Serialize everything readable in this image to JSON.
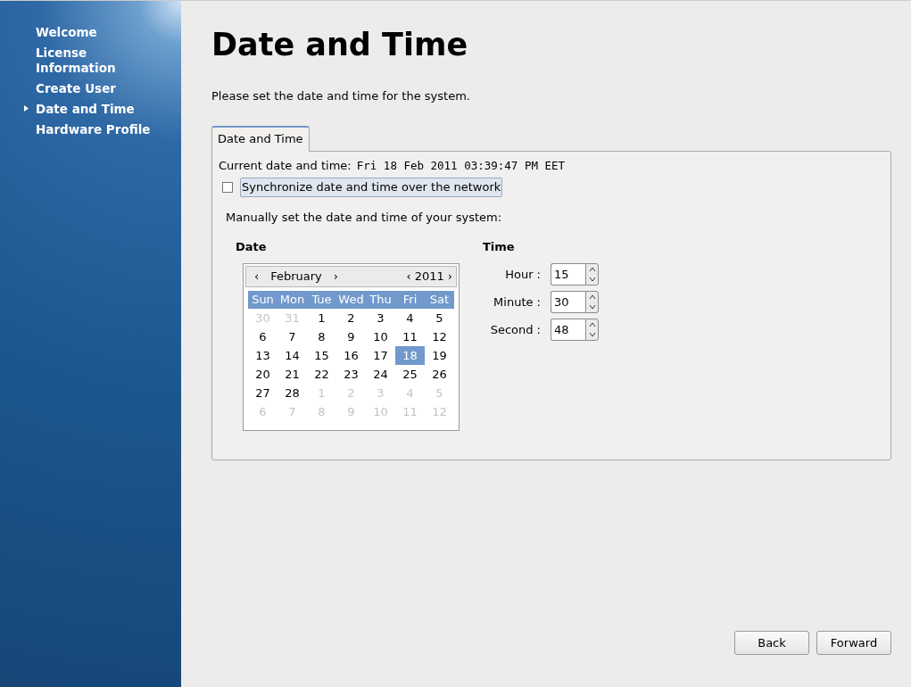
{
  "sidebar": {
    "items": [
      {
        "label": "Welcome",
        "selected": false
      },
      {
        "label": "License Information",
        "selected": false
      },
      {
        "label": "Create User",
        "selected": false
      },
      {
        "label": "Date and Time",
        "selected": true
      },
      {
        "label": "Hardware Profile",
        "selected": false
      }
    ]
  },
  "page": {
    "title": "Date and Time",
    "intro": "Please set the date and time for the system."
  },
  "tabs": [
    {
      "label": "Date and Time",
      "selected": true
    }
  ],
  "current": {
    "label": "Current date and time:",
    "value": "Fri 18 Feb 2011 03:39:47 PM EET"
  },
  "sync": {
    "label": "Synchronize date and time over the network",
    "checked": false
  },
  "manual_label": "Manually set the date and time of your system:",
  "date": {
    "heading": "Date",
    "calendar": {
      "prev_month": "‹",
      "month": "February",
      "next_month": "›",
      "prev_year": "‹",
      "year": "2011",
      "next_year": "›",
      "weekdays": [
        "Sun",
        "Mon",
        "Tue",
        "Wed",
        "Thu",
        "Fri",
        "Sat"
      ],
      "weeks": [
        [
          {
            "day": "30",
            "muted": true,
            "selected": false
          },
          {
            "day": "31",
            "muted": true,
            "selected": false
          },
          {
            "day": "1",
            "muted": false,
            "selected": false
          },
          {
            "day": "2",
            "muted": false,
            "selected": false
          },
          {
            "day": "3",
            "muted": false,
            "selected": false
          },
          {
            "day": "4",
            "muted": false,
            "selected": false
          },
          {
            "day": "5",
            "muted": false,
            "selected": false
          }
        ],
        [
          {
            "day": "6",
            "muted": false,
            "selected": false
          },
          {
            "day": "7",
            "muted": false,
            "selected": false
          },
          {
            "day": "8",
            "muted": false,
            "selected": false
          },
          {
            "day": "9",
            "muted": false,
            "selected": false
          },
          {
            "day": "10",
            "muted": false,
            "selected": false
          },
          {
            "day": "11",
            "muted": false,
            "selected": false
          },
          {
            "day": "12",
            "muted": false,
            "selected": false
          }
        ],
        [
          {
            "day": "13",
            "muted": false,
            "selected": false
          },
          {
            "day": "14",
            "muted": false,
            "selected": false
          },
          {
            "day": "15",
            "muted": false,
            "selected": false
          },
          {
            "day": "16",
            "muted": false,
            "selected": false
          },
          {
            "day": "17",
            "muted": false,
            "selected": false
          },
          {
            "day": "18",
            "muted": false,
            "selected": true
          },
          {
            "day": "19",
            "muted": false,
            "selected": false
          }
        ],
        [
          {
            "day": "20",
            "muted": false,
            "selected": false
          },
          {
            "day": "21",
            "muted": false,
            "selected": false
          },
          {
            "day": "22",
            "muted": false,
            "selected": false
          },
          {
            "day": "23",
            "muted": false,
            "selected": false
          },
          {
            "day": "24",
            "muted": false,
            "selected": false
          },
          {
            "day": "25",
            "muted": false,
            "selected": false
          },
          {
            "day": "26",
            "muted": false,
            "selected": false
          }
        ],
        [
          {
            "day": "27",
            "muted": false,
            "selected": false
          },
          {
            "day": "28",
            "muted": false,
            "selected": false
          },
          {
            "day": "1",
            "muted": true,
            "selected": false
          },
          {
            "day": "2",
            "muted": true,
            "selected": false
          },
          {
            "day": "3",
            "muted": true,
            "selected": false
          },
          {
            "day": "4",
            "muted": true,
            "selected": false
          },
          {
            "day": "5",
            "muted": true,
            "selected": false
          }
        ],
        [
          {
            "day": "6",
            "muted": true,
            "selected": false
          },
          {
            "day": "7",
            "muted": true,
            "selected": false
          },
          {
            "day": "8",
            "muted": true,
            "selected": false
          },
          {
            "day": "9",
            "muted": true,
            "selected": false
          },
          {
            "day": "10",
            "muted": true,
            "selected": false
          },
          {
            "day": "11",
            "muted": true,
            "selected": false
          },
          {
            "day": "12",
            "muted": true,
            "selected": false
          }
        ]
      ]
    }
  },
  "time": {
    "heading": "Time",
    "fields": [
      {
        "label": "Hour :",
        "value": "15"
      },
      {
        "label": "Minute :",
        "value": "30"
      },
      {
        "label": "Second :",
        "value": "48"
      }
    ]
  },
  "buttons": [
    "Back",
    "Forward"
  ]
}
